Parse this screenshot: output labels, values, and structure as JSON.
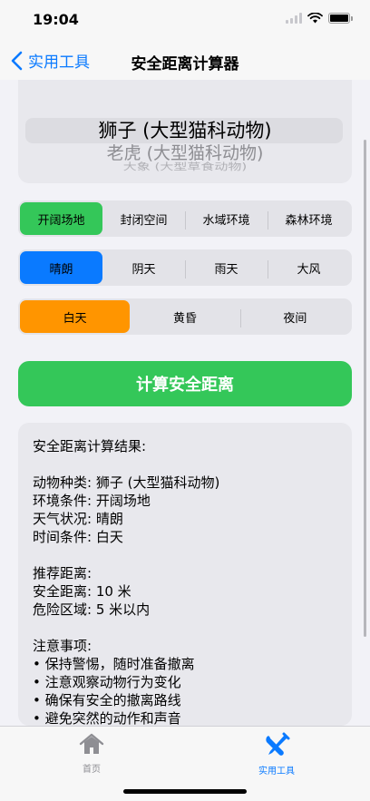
{
  "status": {
    "time": "19:04"
  },
  "nav": {
    "back_label": "实用工具",
    "title": "安全距离计算器"
  },
  "picker": {
    "selected": "狮子 (大型猫科动物)",
    "next": "老虎 (大型猫科动物)",
    "next2": "大象 (大型草食动物)"
  },
  "environment": {
    "options": [
      "开阔场地",
      "封闭空间",
      "水域环境",
      "森林环境"
    ],
    "selected_index": 0
  },
  "weather": {
    "options": [
      "晴朗",
      "阴天",
      "雨天",
      "大风"
    ],
    "selected_index": 0
  },
  "time_of_day": {
    "options": [
      "白天",
      "黄昏",
      "夜间"
    ],
    "selected_index": 0
  },
  "calculate_button": "计算安全距离",
  "result": {
    "lines": [
      "安全距离计算结果:",
      "",
      "动物种类: 狮子 (大型猫科动物)",
      "环境条件: 开阔场地",
      "天气状况: 晴朗",
      "时间条件: 白天",
      "",
      "推荐距离:",
      "安全距离: 10 米",
      "危险区域: 5 米以内",
      "",
      "注意事项:",
      "• 保持警惕，随时准备撤离",
      "• 注意观察动物行为变化",
      "• 确保有安全的撤离路线",
      "• 避免突然的动作和声音"
    ]
  },
  "tabs": [
    {
      "label": "首页",
      "icon": "house-icon",
      "active": false
    },
    {
      "label": "实用工具",
      "icon": "wrench-screwdriver-icon",
      "active": true
    }
  ],
  "colors": {
    "accent_blue": "#0a7aff",
    "green": "#34c759",
    "orange": "#ff9500",
    "tab_inactive": "#8e8e93"
  }
}
